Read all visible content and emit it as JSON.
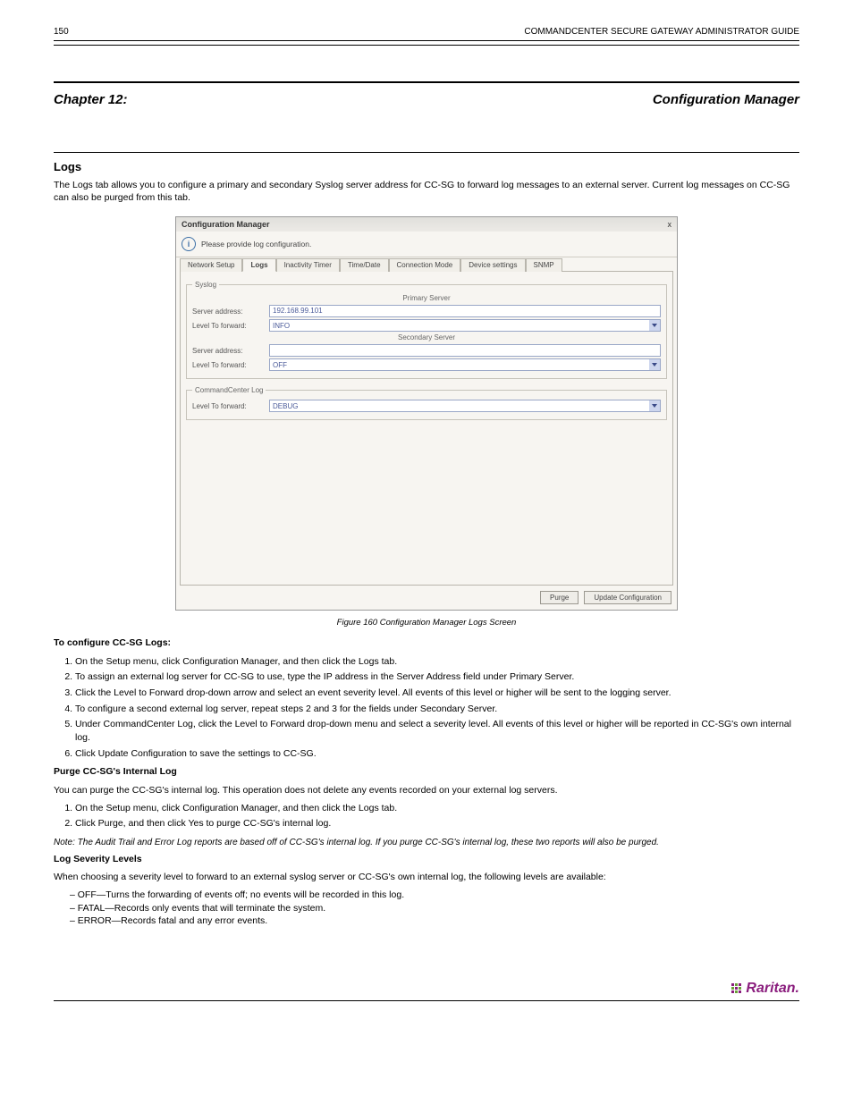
{
  "header": {
    "page": "150",
    "manual": "COMMANDCENTER SECURE GATEWAY ADMINISTRATOR GUIDE"
  },
  "chapter": {
    "num": "Chapter 12:",
    "title": "Configuration Manager"
  },
  "section": {
    "title": "Logs",
    "para": "The Logs tab allows you to configure a primary and secondary Syslog server address for CC-SG to forward log messages to an external server. Current log messages on CC-SG can also be purged from this tab."
  },
  "window": {
    "title": "Configuration Manager",
    "close": "x",
    "info": "Please provide log configuration.",
    "tabs": [
      "Network Setup",
      "Logs",
      "Inactivity Timer",
      "Time/Date",
      "Connection Mode",
      "Device settings",
      "SNMP"
    ],
    "activeTab": 1,
    "syslogLegend": "Syslog",
    "primary": "Primary Server",
    "secondary": "Secondary Server",
    "ccLegend": "CommandCenter Log",
    "labels": {
      "addr": "Server address:",
      "level": "Level To forward:"
    },
    "vals": {
      "addr1": "192.168.99.101",
      "lvl1": "INFO",
      "addr2": "",
      "lvl2": "OFF",
      "lvl3": "DEBUG"
    },
    "buttons": {
      "purge": "Purge",
      "update": "Update Configuration"
    }
  },
  "caption": "Figure 160 Configuration Manager Logs Screen",
  "configLogs": {
    "h": "To configure CC-SG Logs:",
    "steps": [
      "On the Setup menu, click Configuration Manager, and then click the Logs tab.",
      "To assign an external log server for CC-SG to use, type the IP address in the Server Address field under Primary Server.",
      "Click the Level to Forward drop-down arrow and select an event severity level. All events of this level or higher will be sent to the logging server.",
      "To configure a second external log server, repeat steps 2 and 3 for the fields under Secondary Server.",
      "Under CommandCenter Log, click the Level to Forward drop-down menu and select a severity level. All events of this level or higher will be reported in CC-SG's own internal log.",
      "Click Update Configuration to save the settings to CC-SG."
    ]
  },
  "purge": {
    "h": "Purge CC-SG's Internal Log",
    "p": "You can purge the CC-SG's internal log. This operation does not delete any events recorded on your external log servers.",
    "s1": "On the Setup menu, click Configuration Manager, and then click the Logs tab.",
    "s2": "Click Purge, and then click Yes to purge CC-SG's internal log."
  },
  "note": "Note: The Audit Trail and Error Log reports are based off of CC-SG's internal log. If you purge CC-SG's internal log, these two reports will also be purged.",
  "severities": {
    "h": "Log Severity Levels",
    "p": "When choosing a severity level to forward to an external syslog server or CC-SG's own internal log, the following levels are available:",
    "items": [
      "OFF—Turns the forwarding of events off; no events will be recorded in this log.",
      "FATAL—Records only events that will terminate the system.",
      "ERROR—Records fatal and any error events."
    ]
  },
  "footer": {
    "brand": "Raritan."
  }
}
